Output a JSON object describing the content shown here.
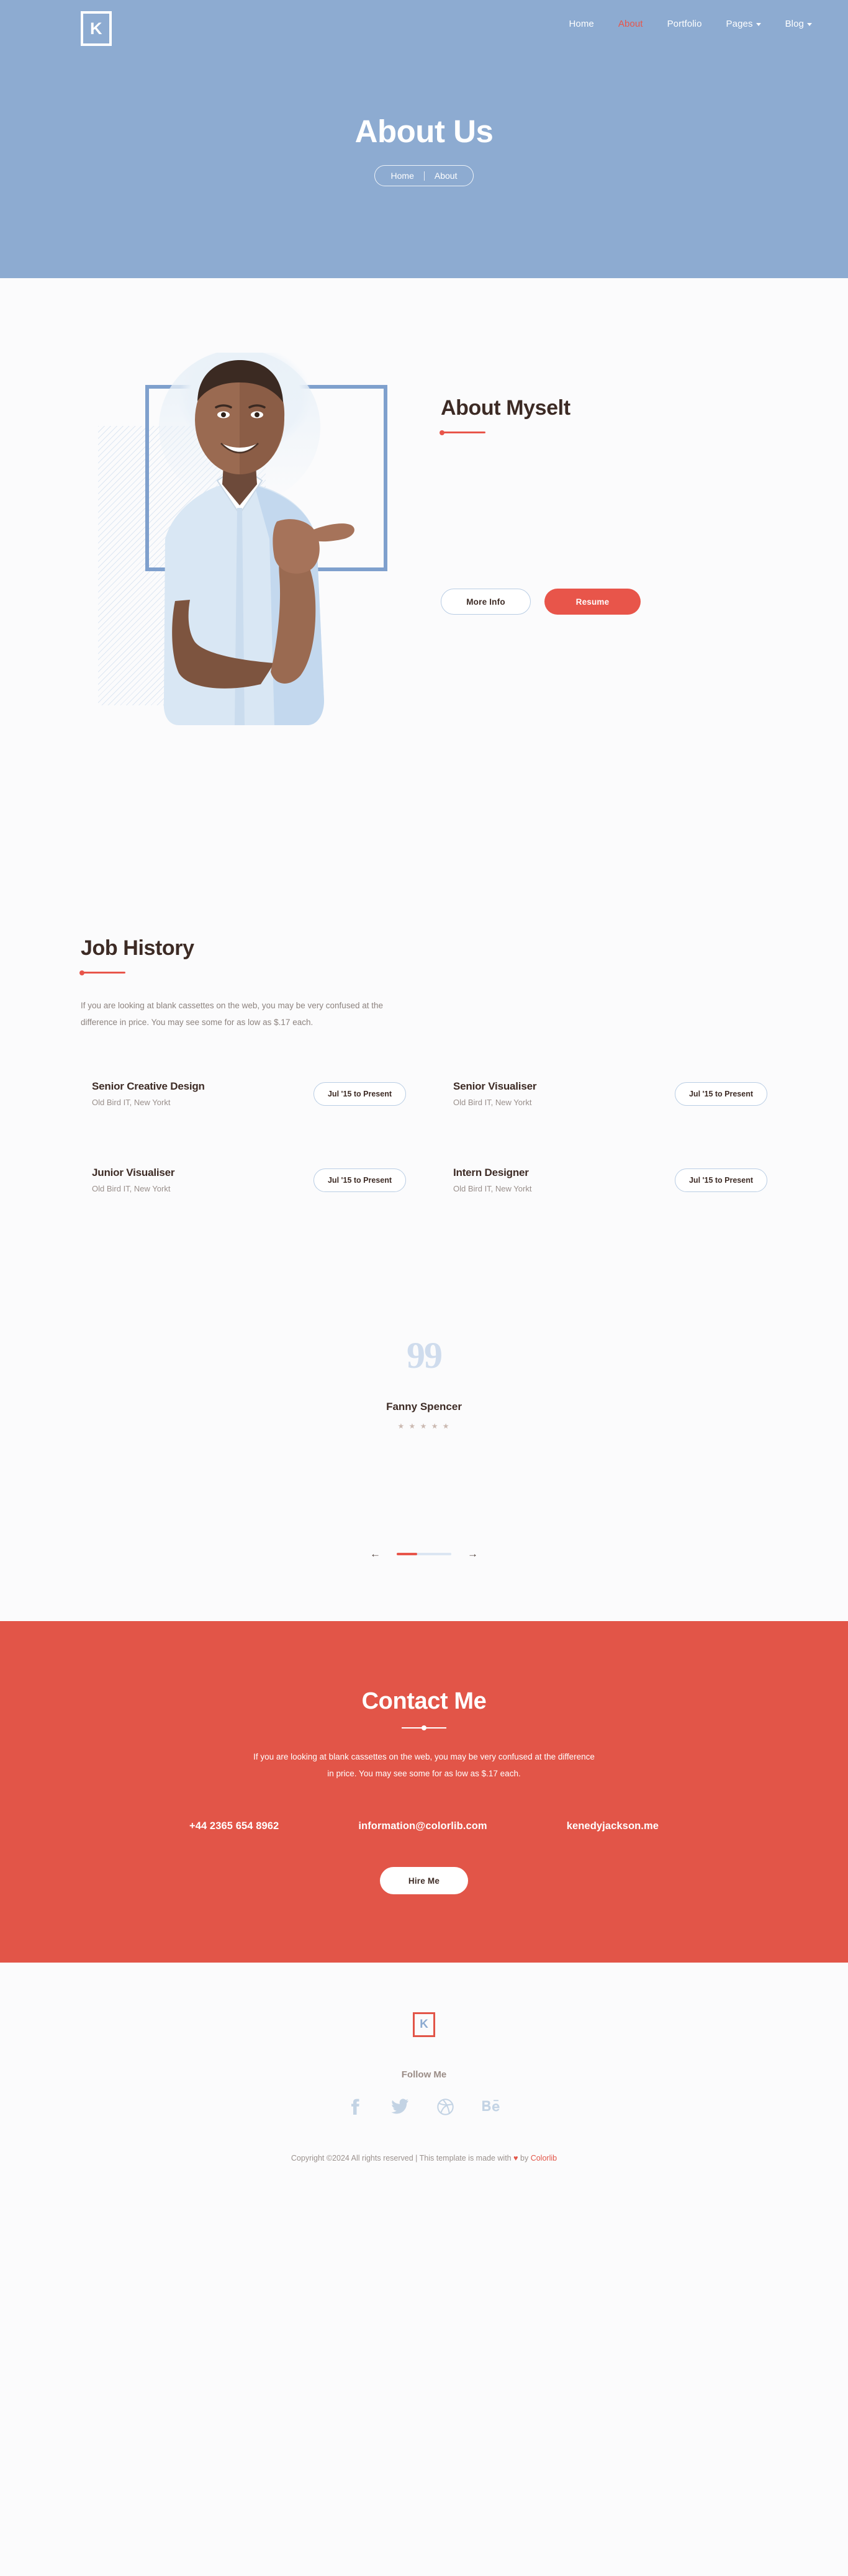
{
  "header": {
    "logo_letter": "K",
    "nav": [
      {
        "label": "Home",
        "active": false,
        "dropdown": false
      },
      {
        "label": "About",
        "active": true,
        "dropdown": false
      },
      {
        "label": "Portfolio",
        "active": false,
        "dropdown": false
      },
      {
        "label": "Pages",
        "active": false,
        "dropdown": true
      },
      {
        "label": "Blog",
        "active": false,
        "dropdown": true
      }
    ]
  },
  "hero": {
    "title": "About Us",
    "breadcrumb_home": "Home",
    "breadcrumb_current": "About"
  },
  "about": {
    "title": "About Myselt",
    "more_info_label": "More Info",
    "resume_label": "Resume"
  },
  "jobs": {
    "title": "Job History",
    "description": "If you are looking at blank cassettes on the web, you may be very confused at the difference in price. You may see some for as low as $.17 each.",
    "items": [
      {
        "role": "Senior Creative Design",
        "company": "Old Bird IT, New Yorkt",
        "period": "Jul '15 to Present"
      },
      {
        "role": "Senior Visualiser",
        "company": "Old Bird IT, New Yorkt",
        "period": "Jul '15 to Present"
      },
      {
        "role": "Junior Visualiser",
        "company": "Old Bird IT, New Yorkt",
        "period": "Jul '15 to Present"
      },
      {
        "role": "Intern Designer",
        "company": "Old Bird IT, New Yorkt",
        "period": "Jul '15 to Present"
      }
    ]
  },
  "testimonial": {
    "quote_mark": "99",
    "author": "Fanny Spencer",
    "stars": "★ ★ ★ ★ ★",
    "rating": 5,
    "prev_label": "←",
    "next_label": "→",
    "progress_percent": 38
  },
  "contact": {
    "title": "Contact Me",
    "description": "If you are looking at blank cassettes on the web, you may be very confused at the difference in price. You may see some for as low as $.17 each.",
    "phone": "+44 2365 654 8962",
    "email": "information@colorlib.com",
    "website": "kenedyjackson.me",
    "hire_label": "Hire Me",
    "accent_color": "#e25548"
  },
  "footer": {
    "logo_letter": "K",
    "follow_label": "Follow Me",
    "socials": [
      "facebook-icon",
      "twitter-icon",
      "dribbble-icon",
      "behance-icon"
    ],
    "copyright_prefix": "Copyright ©2024 All rights reserved | This template is made with ",
    "copyright_heart": "♥",
    "copyright_middle": " by ",
    "copyright_brand": "Colorlib"
  }
}
